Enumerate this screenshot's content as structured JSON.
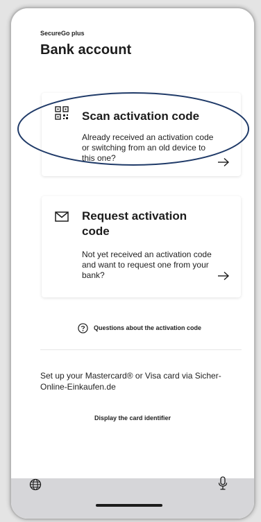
{
  "app": {
    "label": "SecureGo plus",
    "title": "Bank account"
  },
  "cards": {
    "scan": {
      "icon": "qr-code-icon",
      "title": "Scan activation code",
      "description": "Already received an activation code or switching from an old device to this one?",
      "arrow_icon": "arrow-right-icon"
    },
    "request": {
      "icon": "envelope-icon",
      "title": "Request activation code",
      "description": "Not yet received an activation code and want to request one from your bank?",
      "arrow_icon": "arrow-right-icon"
    }
  },
  "help": {
    "icon": "question-circle-icon",
    "label": "Questions about the activation code"
  },
  "card_setup": {
    "text": "Set up your Mastercard® or Visa card via Sicher-Online-Einkaufen.de",
    "link": "Display the card identifier"
  },
  "keyboard_bar": {
    "left_icon": "globe-icon",
    "right_icon": "microphone-icon"
  },
  "annotation": {
    "color": "#1f3a68"
  }
}
